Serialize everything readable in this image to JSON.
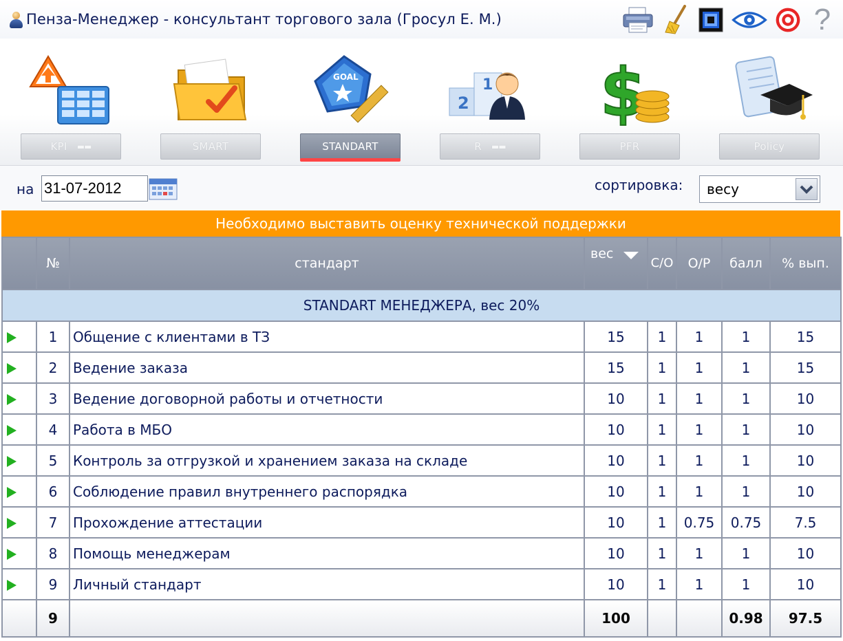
{
  "titlebar": {
    "title": "Пенза-Менеджер - консультант торгового зала  (Гросул Е. М.)",
    "tools": [
      "printer-icon",
      "broom-icon",
      "screen-icon",
      "eye-icon",
      "target-icon",
      "help-icon"
    ],
    "help_symbol": "?"
  },
  "modules": [
    {
      "label": "KPI",
      "icon": "kpi-chart-icon",
      "active": false
    },
    {
      "label": "SMART",
      "icon": "folder-check-icon",
      "active": false
    },
    {
      "label": "STANDART",
      "icon": "goal-badge-icon",
      "active": true
    },
    {
      "label": "R",
      "icon": "ranking-podium-icon",
      "active": false
    },
    {
      "label": "PFR",
      "icon": "dollar-coins-icon",
      "active": false
    },
    {
      "label": "Policy",
      "icon": "diploma-cap-icon",
      "active": false
    }
  ],
  "filters": {
    "date_label": "на",
    "date_value": "31-07-2012",
    "sort_label": "сортировка:",
    "sort_value": "весу"
  },
  "banner": "Необходимо выставить оценку технической поддержки",
  "table": {
    "headers": {
      "num": "№",
      "standard": "стандарт",
      "weight": "вес",
      "co": "С/О",
      "op": "О/Р",
      "score": "балл",
      "pct": "% вып."
    },
    "section": "STANDART МЕНЕДЖЕРА, вес 20%",
    "rows": [
      {
        "n": "1",
        "name": "Общение с клиентами в ТЗ",
        "weight": "15",
        "co": "1",
        "op": "1",
        "score": "1",
        "pct": "15"
      },
      {
        "n": "2",
        "name": "Ведение заказа",
        "weight": "15",
        "co": "1",
        "op": "1",
        "score": "1",
        "pct": "15"
      },
      {
        "n": "3",
        "name": "Ведение договорной работы и отчетности",
        "weight": "10",
        "co": "1",
        "op": "1",
        "score": "1",
        "pct": "10"
      },
      {
        "n": "4",
        "name": "Работа в МБО",
        "weight": "10",
        "co": "1",
        "op": "1",
        "score": "1",
        "pct": "10"
      },
      {
        "n": "5",
        "name": "Контроль за отгрузкой и хранением заказа на складе",
        "weight": "10",
        "co": "1",
        "op": "1",
        "score": "1",
        "pct": "10"
      },
      {
        "n": "6",
        "name": "Соблюдение правил внутреннего распорядка",
        "weight": "10",
        "co": "1",
        "op": "1",
        "score": "1",
        "pct": "10"
      },
      {
        "n": "7",
        "name": "Прохождение аттестации",
        "weight": "10",
        "co": "1",
        "op": "0.75",
        "score": "0.75",
        "pct": "7.5"
      },
      {
        "n": "8",
        "name": "Помощь менеджерам",
        "weight": "10",
        "co": "1",
        "op": "1",
        "score": "1",
        "pct": "10"
      },
      {
        "n": "9",
        "name": "Личный стандарт",
        "weight": "10",
        "co": "1",
        "op": "1",
        "score": "1",
        "pct": "10"
      }
    ],
    "totals": {
      "count": "9",
      "weight": "100",
      "score": "0.98",
      "pct": "97.5"
    }
  },
  "colors": {
    "banner": "#ff9900",
    "header": "#8f97a8",
    "section": "#c7dcf0",
    "active_underline": "#ff4545",
    "play": "#22b020"
  }
}
